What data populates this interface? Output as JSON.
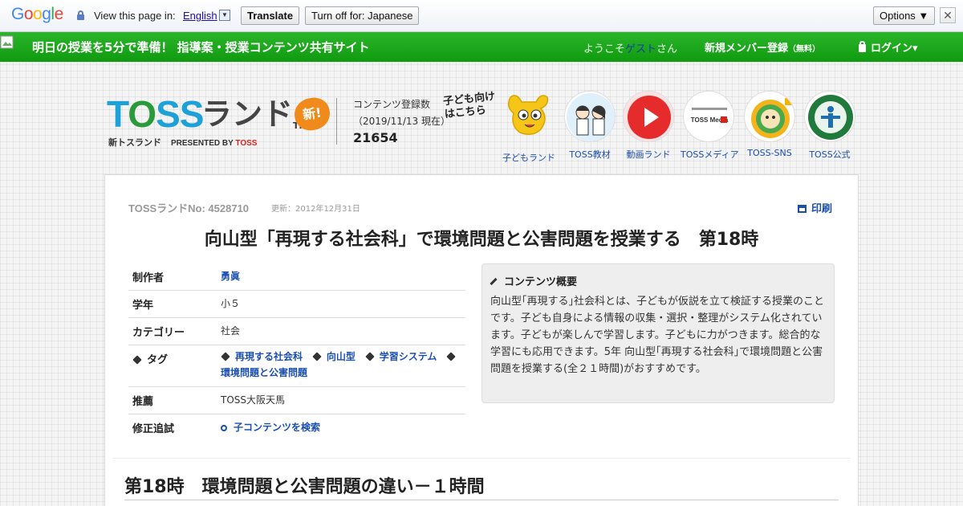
{
  "translate_bar": {
    "logo": "Google",
    "view_text": "View this page in:",
    "language": "English",
    "translate_btn": "Translate",
    "turn_off_btn": "Turn off for: Japanese",
    "options_btn": "Options ▼",
    "close": "✕"
  },
  "nav": {
    "tagline": "明日の授業を5分で準備！ 指導案・授業コンテンツ共有サイト",
    "welcome_prefix": "ようこそ",
    "guest": "ゲスト",
    "welcome_suffix": "さん",
    "register": "新規メンバー登録",
    "register_note": "（無料）",
    "login": "ログイン▾"
  },
  "header": {
    "logo_toss": "TOSS",
    "logo_land": "ランド",
    "logo_tm": "TM",
    "logo_new": "新!",
    "logo_sub": "新トスランド",
    "logo_presented": "PRESENTED BY",
    "logo_presented_brand": "TOSS",
    "count_label": "コンテンツ登録数",
    "count_date": "（2019/11/13 現在）",
    "count_value": "21654",
    "kids_callout": "子ども向け\nはこちら",
    "icons": [
      {
        "label": "子どもランド"
      },
      {
        "label": "TOSS教材"
      },
      {
        "label": "動画ランド"
      },
      {
        "label": "TOSSメディア",
        "inner": "TOSS Media"
      },
      {
        "label": "TOSS-SNS"
      },
      {
        "label": "TOSS公式"
      }
    ]
  },
  "content": {
    "toss_no": "TOSSランドNo: 4528710",
    "updated": "更新：2012年12月31日",
    "print": "印刷",
    "title": "向山型「再現する社会科」で環境問題と公害問題を授業する　第18時",
    "meta": {
      "author_label": "制作者",
      "author": "勇眞",
      "grade_label": "学年",
      "grade": "小５",
      "category_label": "カテゴリー",
      "category": "社会",
      "tag_label": "タグ",
      "tags": [
        "再現する社会科",
        "向山型",
        "学習システム",
        "環境問題と公害問題"
      ],
      "recommend_label": "推薦",
      "recommend": "TOSS大阪天馬",
      "revision_label": "修正追試",
      "revision": "子コンテンツを検索"
    },
    "summary_heading": "コンテンツ概要",
    "summary_text": "向山型｢再現する｣社会科とは、子どもが仮説を立て検証する授業のことです。子ども自身による情報の収集・選択・整理がシステム化されています。子どもが楽しんで学習します。子どもに力がつきます。総合的な学習にも応用できます。5年 向山型｢再現する社会科｣で環境問題と公害問題を授業する(全２１時間)がおすすめです。",
    "section_title": "第18時　環境問題と公害問題の違い－１時間"
  },
  "colors": {
    "nav_green": "#14a114",
    "link_blue": "#1a4fb0",
    "guest_blue": "#143ca8",
    "logo_blue": "#1ea0d8",
    "brand_red": "#d9241b"
  }
}
